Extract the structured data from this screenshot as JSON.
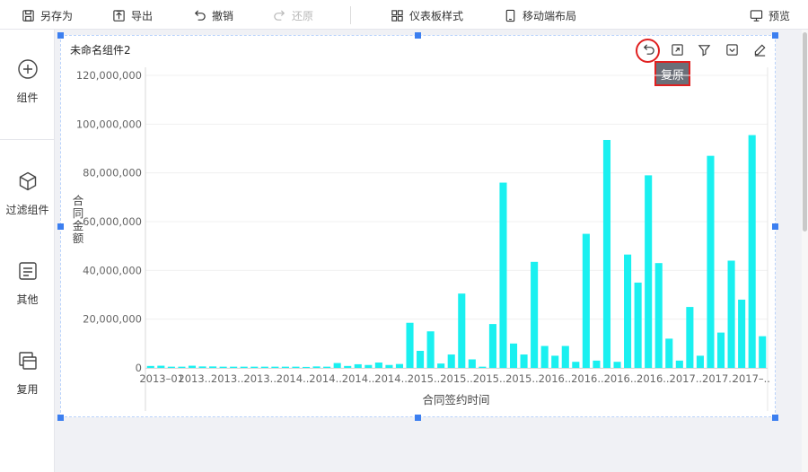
{
  "toolbar": {
    "save_as": "另存为",
    "export": "导出",
    "undo": "撤销",
    "redo": "还原",
    "dashboard_style": "仪表板样式",
    "mobile_layout": "移动端布局",
    "preview": "预览"
  },
  "sidebar": {
    "items": [
      {
        "label": "组件",
        "icon": "plus-circle-icon"
      },
      {
        "label": "过滤组件",
        "icon": "cube-icon"
      },
      {
        "label": "其他",
        "icon": "document-icon"
      },
      {
        "label": "复用",
        "icon": "copy-icon"
      }
    ]
  },
  "widget": {
    "title": "未命名组件2",
    "tooltip": "复原",
    "icons": [
      "undo-icon",
      "expand-icon",
      "filter-icon",
      "dropdown-icon",
      "edit-icon"
    ]
  },
  "colors": {
    "bar": "#1af0f0",
    "handle": "#3c7ff0",
    "highlight": "#e02020",
    "canvas": "#f0f1f5"
  },
  "chart_data": {
    "type": "bar",
    "xlabel": "合同签约时间",
    "ylabel": "合同金额",
    "ylim": [
      0,
      120000000
    ],
    "yticks": [
      0,
      20000000,
      40000000,
      60000000,
      80000000,
      100000000,
      120000000
    ],
    "ytick_labels": [
      "0",
      "20,000,000",
      "40,000,000",
      "60,000,000",
      "80,000,000",
      "100,000,000",
      "120,000,000"
    ],
    "x_tick_labels": [
      "2013–01",
      "2013..",
      "2013..",
      "2013..",
      "2014..",
      "2014..",
      "2014..",
      "2014..",
      "2015..",
      "2015..",
      "2015..",
      "2015..",
      "2016..",
      "2016..",
      "2016..",
      "2016..",
      "2017..",
      "2017..",
      "2017–.."
    ],
    "values": [
      800000,
      900000,
      500000,
      500000,
      900000,
      600000,
      600000,
      500000,
      500000,
      500000,
      500000,
      500000,
      500000,
      500000,
      500000,
      400000,
      600000,
      500000,
      2000000,
      800000,
      1500000,
      1200000,
      2200000,
      1200000,
      1600000,
      18500000,
      7000000,
      15000000,
      1800000,
      5500000,
      30500000,
      3500000,
      500000,
      18000000,
      76000000,
      10000000,
      5500000,
      43500000,
      9000000,
      5000000,
      9000000,
      2500000,
      55000000,
      3000000,
      93500000,
      2500000,
      46500000,
      35000000,
      79000000,
      43000000,
      12000000,
      3000000,
      25000000,
      5000000,
      87000000,
      14500000,
      44000000,
      28000000,
      95500000,
      13000000
    ]
  }
}
